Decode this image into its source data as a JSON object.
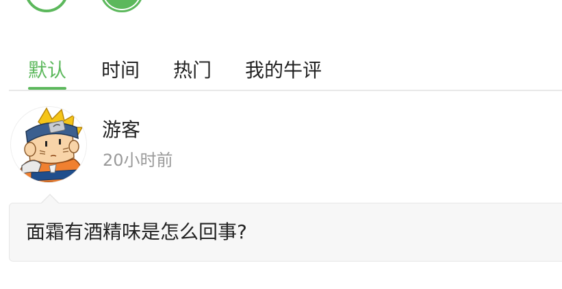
{
  "tabs": [
    {
      "label": "默认",
      "active": true
    },
    {
      "label": "时间",
      "active": false
    },
    {
      "label": "热门",
      "active": false
    },
    {
      "label": "我的牛评",
      "active": false
    }
  ],
  "comment": {
    "user_name": "游客",
    "time_ago": "20小时前",
    "avatar_icon": "cartoon-ninja-avatar-icon",
    "text": "面霜有酒精味是怎么回事?"
  },
  "colors": {
    "accent": "#5cb85c",
    "muted_text": "#999999",
    "comment_bg": "#f7f7f7"
  }
}
